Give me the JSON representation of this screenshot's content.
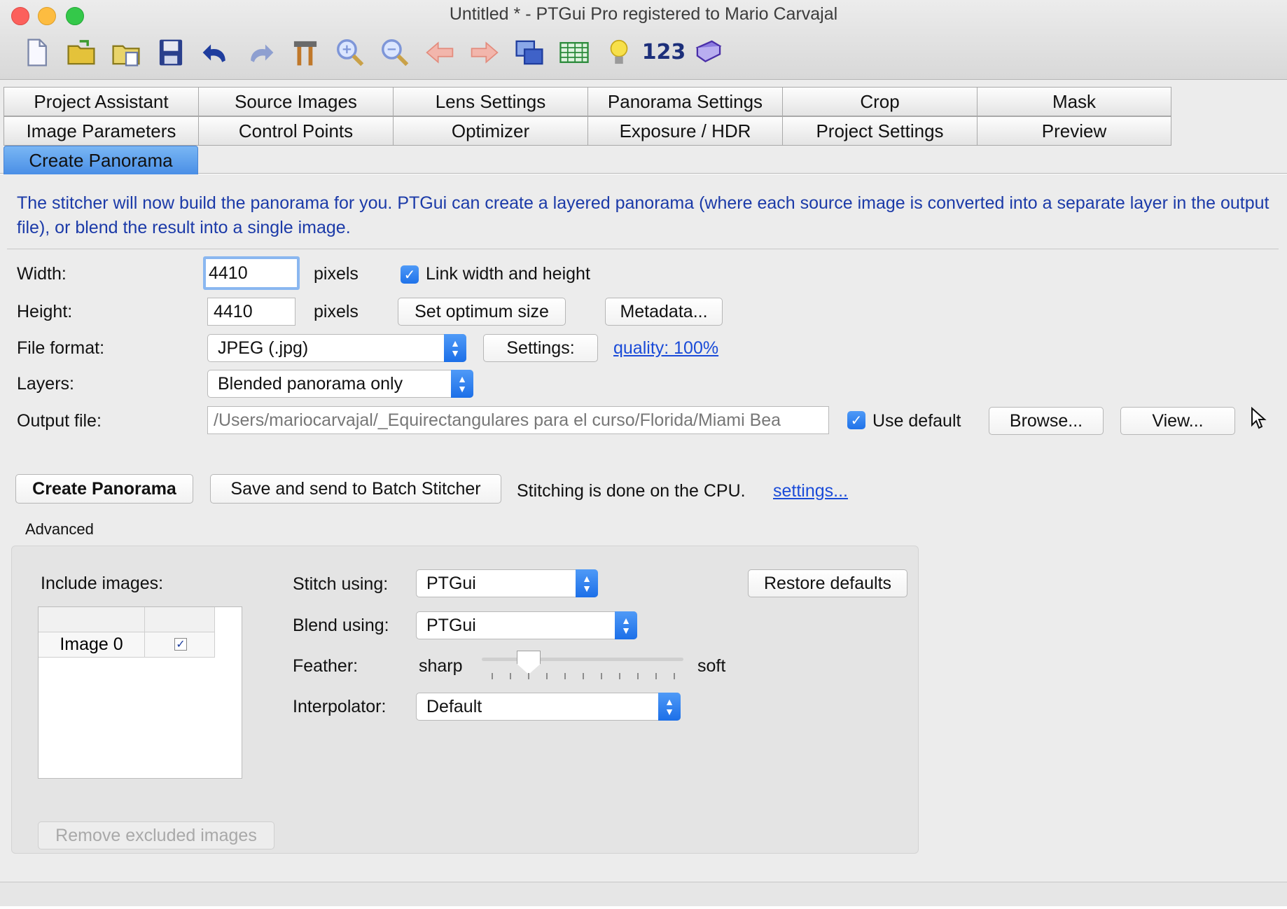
{
  "window": {
    "title": "Untitled * - PTGui Pro registered to Mario Carvajal"
  },
  "toolbar": {
    "icons": [
      "new-file-icon",
      "open-folder-icon",
      "open-recent-icon",
      "save-icon",
      "undo-icon",
      "redo-icon",
      "tools-icon",
      "zoom-in-icon",
      "zoom-out-icon",
      "arrow-left-icon",
      "arrow-right-icon",
      "panorama-editor-icon",
      "table-icon",
      "lightbulb-icon",
      "numbers-icon",
      "help-book-icon"
    ],
    "numbers_label": "123"
  },
  "tabs": {
    "row1": [
      "Project Assistant",
      "Source Images",
      "Lens Settings",
      "Panorama Settings",
      "Crop",
      "Mask"
    ],
    "row2": [
      "Image Parameters",
      "Control Points",
      "Optimizer",
      "Exposure / HDR",
      "Project Settings",
      "Preview"
    ],
    "row3": [
      "Create Panorama"
    ],
    "active": "Create Panorama"
  },
  "intro": "The stitcher will now build the panorama for you. PTGui can create a layered panorama (where each source image is converted into a separate layer in the output file), or blend the result into a single image.",
  "form": {
    "width_label": "Width:",
    "width_value": "4410",
    "width_unit": "pixels",
    "link_label": "Link width and height",
    "link_checked": true,
    "height_label": "Height:",
    "height_value": "4410",
    "height_unit": "pixels",
    "optimum_button": "Set optimum size",
    "metadata_button": "Metadata...",
    "format_label": "File format:",
    "format_value": "JPEG (.jpg)",
    "settings_button": "Settings:",
    "quality_link": "quality: 100%",
    "layers_label": "Layers:",
    "layers_value": "Blended panorama only",
    "output_label": "Output file:",
    "output_value": "/Users/mariocarvajal/_Equirectangulares para el curso/Florida/Miami Bea",
    "use_default_label": "Use default",
    "use_default_checked": true,
    "browse_button": "Browse...",
    "view_button": "View..."
  },
  "actions": {
    "create_button": "Create Panorama",
    "batch_button": "Save and send to Batch Stitcher",
    "status_text": "Stitching is done on the CPU.",
    "settings_link": "settings..."
  },
  "advanced": {
    "title": "Advanced",
    "include_label": "Include images:",
    "images": [
      {
        "name": "Image 0",
        "included": true
      }
    ],
    "remove_button": "Remove excluded images",
    "stitch_label": "Stitch using:",
    "stitch_value": "PTGui",
    "blend_label": "Blend using:",
    "blend_value": "PTGui",
    "feather_label": "Feather:",
    "feather_min": "sharp",
    "feather_max": "soft",
    "interpolator_label": "Interpolator:",
    "interpolator_value": "Default",
    "restore_button": "Restore defaults"
  },
  "colors": {
    "accent": "#4a8fe6",
    "intro_text": "#1b3aa8",
    "link": "#1a4bd8"
  }
}
